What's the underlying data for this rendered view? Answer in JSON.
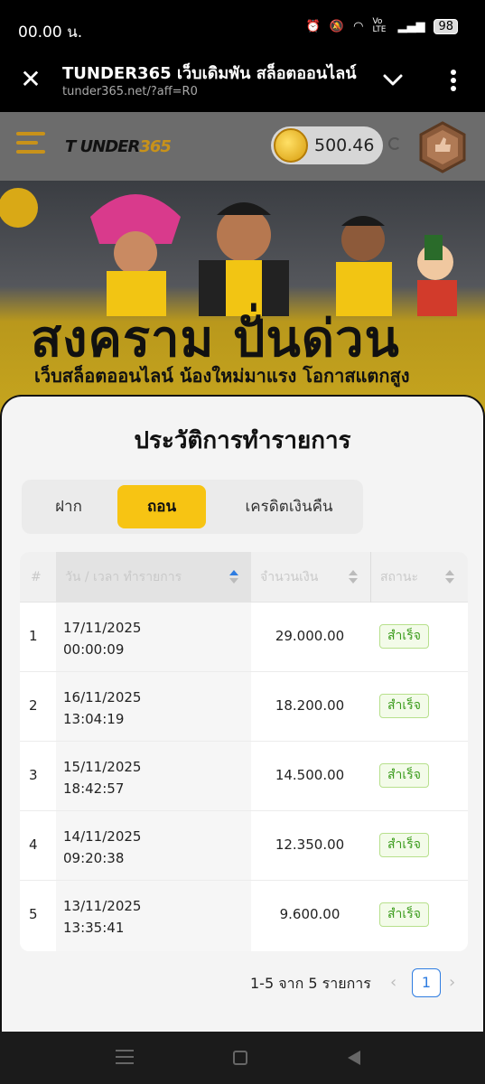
{
  "status_bar": {
    "time": "00.00 น.",
    "battery": "98",
    "volte": "Vo LTE"
  },
  "browser": {
    "title": "TUNDER365 เว็บเดิมพัน สล็อตออนไลน์",
    "url": "tunder365.net/?aff=R0"
  },
  "site": {
    "logo_main": "T UNDER",
    "logo_accent": "365",
    "balance": "500.46"
  },
  "banner": {
    "headline": "สงคราม ปั่นด่วน",
    "subline": "เว็บสล็อตออนไลน์ น้องใหม่มาแรง โอกาสแตกสูง"
  },
  "sheet": {
    "title": "ประวัติการทำรายการ",
    "tabs": [
      {
        "label": "ฝาก",
        "active": false
      },
      {
        "label": "ถอน",
        "active": true
      },
      {
        "label": "เครดิตเงินคืน",
        "active": false
      }
    ],
    "columns": {
      "no": "#",
      "date": "วัน / เวลา ทำรายการ",
      "amount": "จำนวนเงิน",
      "status": "สถานะ"
    },
    "rows": [
      {
        "no": "1",
        "date": "17/11/2025",
        "time": "00:00:09",
        "amount": "29.000.00",
        "status": "สำเร็จ"
      },
      {
        "no": "2",
        "date": "16/11/2025",
        "time": "13:04:19",
        "amount": "18.200.00",
        "status": "สำเร็จ"
      },
      {
        "no": "3",
        "date": "15/11/2025",
        "time": "18:42:57",
        "amount": "14.500.00",
        "status": "สำเร็จ"
      },
      {
        "no": "4",
        "date": "14/11/2025",
        "time": "09:20:38",
        "amount": "12.350.00",
        "status": "สำเร็จ"
      },
      {
        "no": "5",
        "date": "13/11/2025",
        "time": "13:35:41",
        "amount": "9.600.00",
        "status": "สำเร็จ"
      }
    ],
    "pagination": {
      "info": "1-5 จาก 5 รายการ",
      "current_page": "1",
      "prev": "‹",
      "next": "›"
    }
  },
  "colors": {
    "accent": "#f7c413",
    "success": "#3a9b1b",
    "link": "#2f7de1"
  }
}
